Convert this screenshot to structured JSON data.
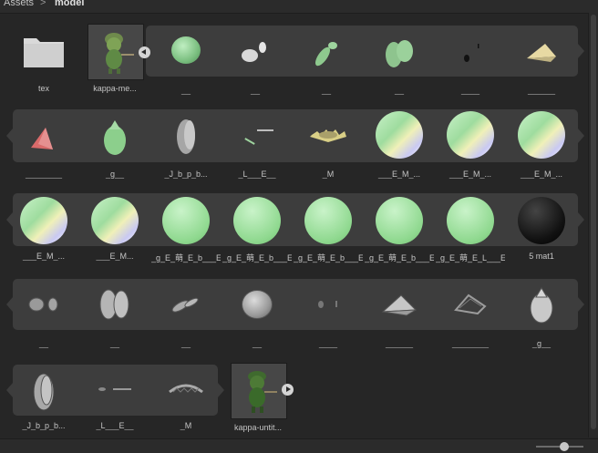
{
  "breadcrumb": {
    "root": "Assets",
    "separator": ">",
    "current": "model"
  },
  "colors": {
    "background": "#262626",
    "strip": "#3d3d3d",
    "label": "#c4c4c4",
    "green_ball": "#86d08a",
    "folder": "#d9d9d9"
  },
  "icons": [
    "folder-icon",
    "expand-left-icon",
    "expand-right-icon",
    "mesh-icon",
    "material-icon",
    "model-prefab-icon"
  ],
  "rows": [
    [
      "tex",
      "kappa-me...",
      "__",
      "__",
      "__",
      "__",
      "____",
      "______"
    ],
    [
      "________",
      "_g__",
      "_J_b_p_b...",
      "_L___E__",
      "_M",
      "___E_M_...",
      "___E_M_...",
      "___E_M_..."
    ],
    [
      "___E_M_...",
      "___E_M...",
      "_g_E_萌_E_b___E...",
      "_g_E_萌_E_b___E...",
      "_g_E_萌_E_b___E...",
      "_g_E_萌_E_b___E...",
      "_g_E_萌_E_L___E...",
      "5 mat1"
    ],
    [
      "__",
      "__",
      "__",
      "__",
      "____",
      "______",
      "________",
      "_g__"
    ],
    [
      "_J_b_p_b...",
      "_L___E__",
      "_M",
      "kappa-untit..."
    ]
  ],
  "zoom": {
    "value": 0.65
  }
}
